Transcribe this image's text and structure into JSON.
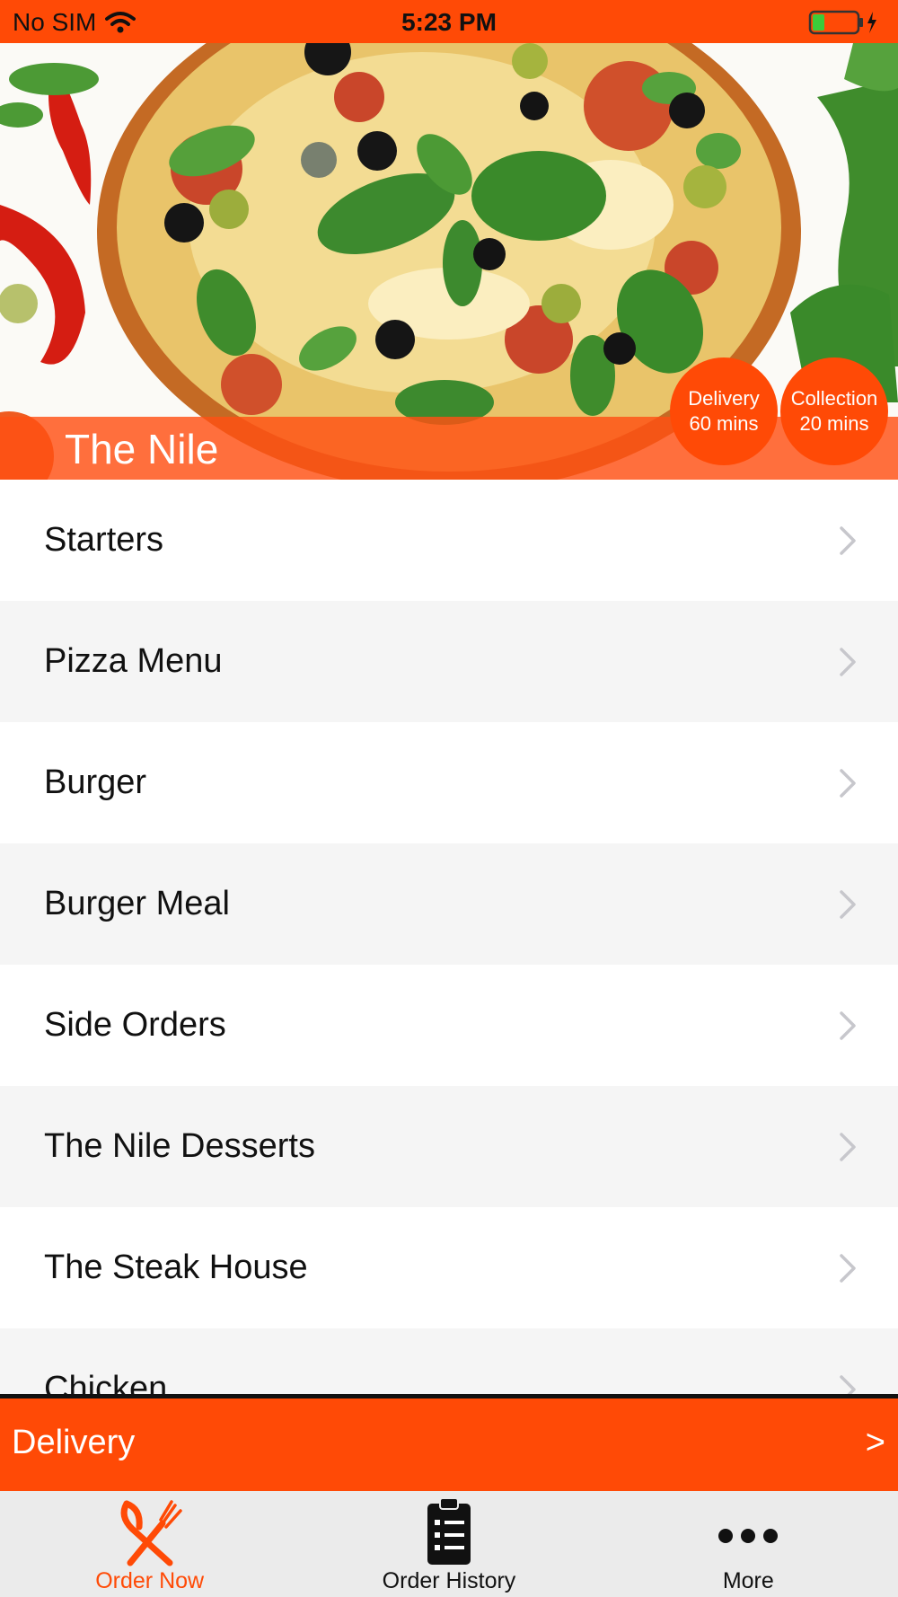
{
  "status_bar": {
    "carrier": "No SIM",
    "time": "5:23 PM",
    "wifi_icon": "wifi-icon",
    "battery_icon": "battery-charging-icon"
  },
  "hero": {
    "restaurant_name": "The Nile",
    "image": "pizza-photo",
    "badges": {
      "delivery_line1": "Delivery",
      "delivery_line2": "60 mins",
      "collection_line1": "Collection",
      "collection_line2": "20 mins"
    }
  },
  "menu": {
    "items": [
      {
        "label": "Starters"
      },
      {
        "label": "Pizza Menu"
      },
      {
        "label": "Burger"
      },
      {
        "label": "Burger Meal"
      },
      {
        "label": "Side Orders"
      },
      {
        "label": "The Nile Desserts"
      },
      {
        "label": "The Steak House"
      },
      {
        "label": "Chicken"
      }
    ],
    "chevron_icon": "chevron-right-icon"
  },
  "delivery_bar": {
    "label": "Delivery",
    "arrow": ">"
  },
  "tab_bar": {
    "tabs": [
      {
        "label": "Order Now",
        "icon": "fork-knife-icon",
        "active": true
      },
      {
        "label": "Order History",
        "icon": "clipboard-icon",
        "active": false
      },
      {
        "label": "More",
        "icon": "more-dots-icon",
        "active": false
      }
    ]
  },
  "colors": {
    "accent": "#ff4a06",
    "row_alt": "#f5f5f5",
    "tab_bar_bg": "#ebebeb"
  }
}
